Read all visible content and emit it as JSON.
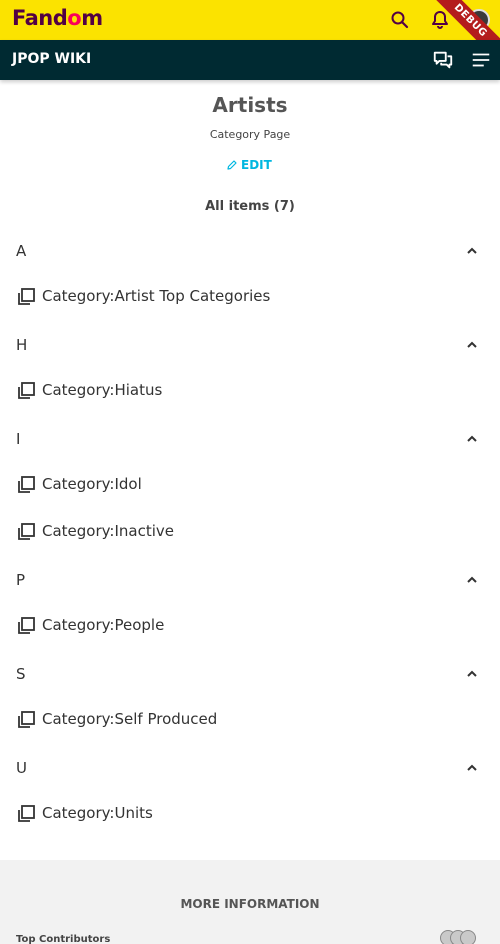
{
  "brand": {
    "logo_text_a": "Fand",
    "logo_text_o": "o",
    "logo_text_b": "m",
    "debug_label": "DEBUG"
  },
  "community": {
    "title": "JPOP WIKI"
  },
  "header": {
    "title": "Artists",
    "subtitle": "Category Page",
    "edit_label": "EDIT",
    "all_items": "All items (7)"
  },
  "groups": [
    {
      "letter": "A",
      "items": [
        "Category:Artist Top Categories"
      ]
    },
    {
      "letter": "H",
      "items": [
        "Category:Hiatus"
      ]
    },
    {
      "letter": "I",
      "items": [
        "Category:Idol",
        "Category:Inactive"
      ]
    },
    {
      "letter": "P",
      "items": [
        "Category:People"
      ]
    },
    {
      "letter": "S",
      "items": [
        "Category:Self Produced"
      ]
    },
    {
      "letter": "U",
      "items": [
        "Category:Units"
      ]
    }
  ],
  "footer": {
    "more_info": "MORE INFORMATION",
    "top_contributors": "Top Contributors"
  },
  "colors": {
    "fandom_yellow": "#fbe300",
    "community_dark": "#002a32",
    "link_blue": "#00b7e0",
    "debug_red": "#b41c1c"
  }
}
